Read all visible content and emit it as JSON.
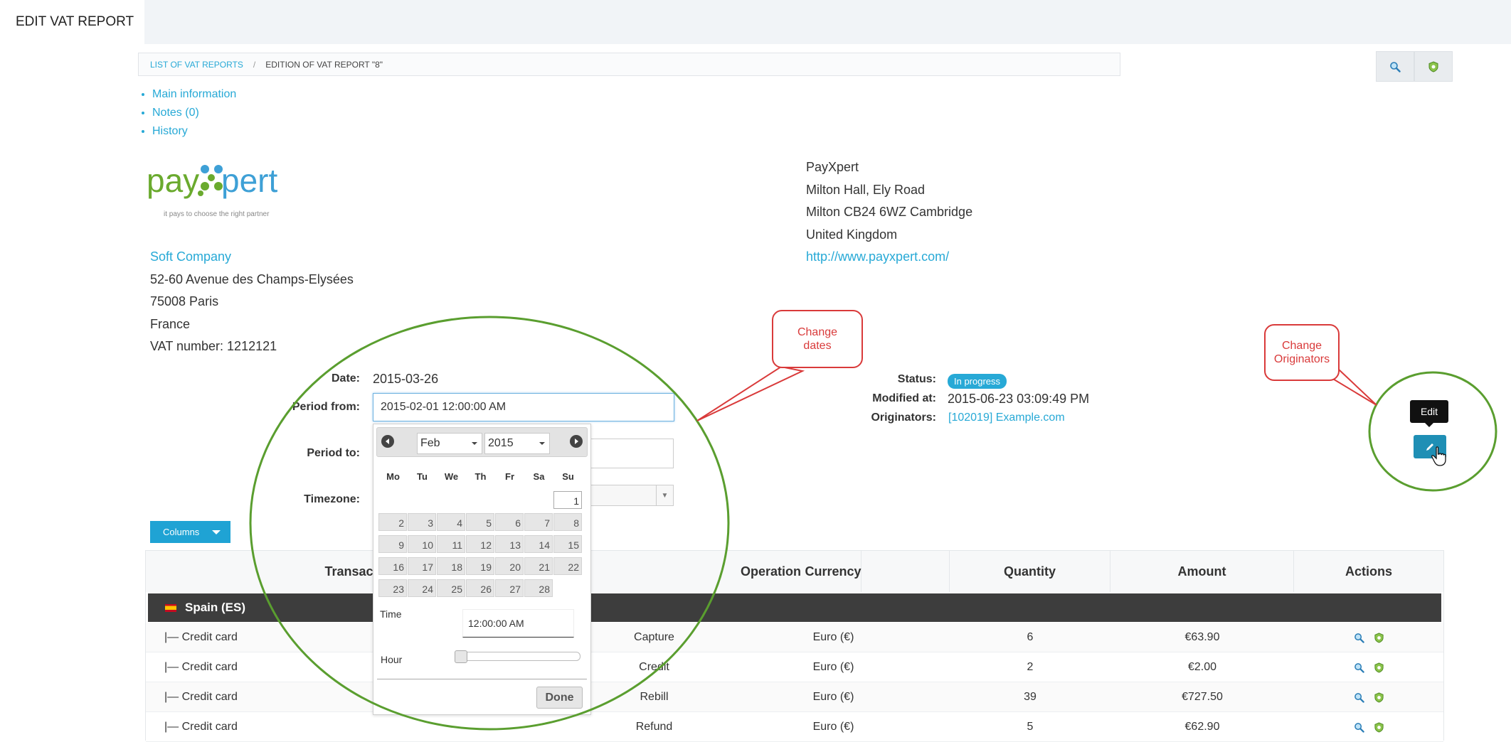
{
  "page": {
    "title": "EDIT VAT REPORT"
  },
  "breadcrumb": {
    "parent": "LIST OF VAT REPORTS",
    "separator": "/",
    "current": "EDITION OF VAT REPORT \"8\""
  },
  "tabs": [
    {
      "label": "Main information"
    },
    {
      "label": "Notes (0)"
    },
    {
      "label": "History"
    }
  ],
  "logo": {
    "text_pay": "pay",
    "text_pert": "pert",
    "tagline": "it pays to choose the right partner"
  },
  "client": {
    "name": "Soft Company",
    "address1": "52-60 Avenue des Champs-Elysées",
    "address2": "75008 Paris",
    "country": "France",
    "vat": "VAT number: 1212121"
  },
  "company": {
    "name": "PayXpert",
    "address1": "Milton Hall, Ely Road",
    "address2": "Milton CB24 6WZ Cambridge",
    "country": "United Kingdom",
    "url": "http://www.payxpert.com/"
  },
  "form": {
    "date_label": "Date:",
    "date_value": "2015-03-26",
    "period_from_label": "Period from:",
    "period_from_value": "2015-02-01 12:00:00 AM",
    "period_to_label": "Period to:",
    "timezone_label": "Timezone:"
  },
  "status_block": {
    "status_label": "Status:",
    "status_value": "In progress",
    "modified_label": "Modified at:",
    "modified_value": "2015-06-23 03:09:49 PM",
    "originators_label": "Originators:",
    "originators_value": "[102019] Example.com"
  },
  "columns_button": {
    "label": "Columns"
  },
  "table": {
    "headers": [
      "Transaction ty",
      "Operation",
      "Currency",
      "Quantity",
      "Amount",
      "Actions"
    ],
    "group": "Spain (ES)",
    "rows": [
      {
        "type": "|— Credit card",
        "operation": "Capture",
        "currency": "Euro (€)",
        "quantity": "6",
        "amount": "€63.90"
      },
      {
        "type": "|— Credit card",
        "operation": "Credit",
        "currency": "Euro (€)",
        "quantity": "2",
        "amount": "€2.00"
      },
      {
        "type": "|— Credit card",
        "operation": "Rebill",
        "currency": "Euro (€)",
        "quantity": "39",
        "amount": "€727.50"
      },
      {
        "type": "|— Credit card",
        "operation": "Refund",
        "currency": "Euro (€)",
        "quantity": "5",
        "amount": "€62.90"
      }
    ]
  },
  "datepicker": {
    "month": "Feb",
    "year": "2015",
    "weekdays": [
      "Mo",
      "Tu",
      "We",
      "Th",
      "Fr",
      "Sa",
      "Su"
    ],
    "days": [
      "1",
      "2",
      "3",
      "4",
      "5",
      "6",
      "7",
      "8",
      "9",
      "10",
      "11",
      "12",
      "13",
      "14",
      "15",
      "16",
      "17",
      "18",
      "19",
      "20",
      "21",
      "22",
      "23",
      "24",
      "25",
      "26",
      "27",
      "28"
    ],
    "time_label": "Time",
    "time_value": "12:00:00 AM",
    "hour_label": "Hour",
    "hour_value": 0,
    "done_label": "Done"
  },
  "annotations": {
    "change_dates": [
      "Change",
      "dates"
    ],
    "change_originators": [
      "Change",
      "Originators"
    ],
    "edit_tooltip": "Edit"
  },
  "colors": {
    "accent": "#27a9d6",
    "annotation_red": "#d93a3a",
    "annotation_green": "#5a9e2f",
    "table_group": "#3d3d3d"
  }
}
